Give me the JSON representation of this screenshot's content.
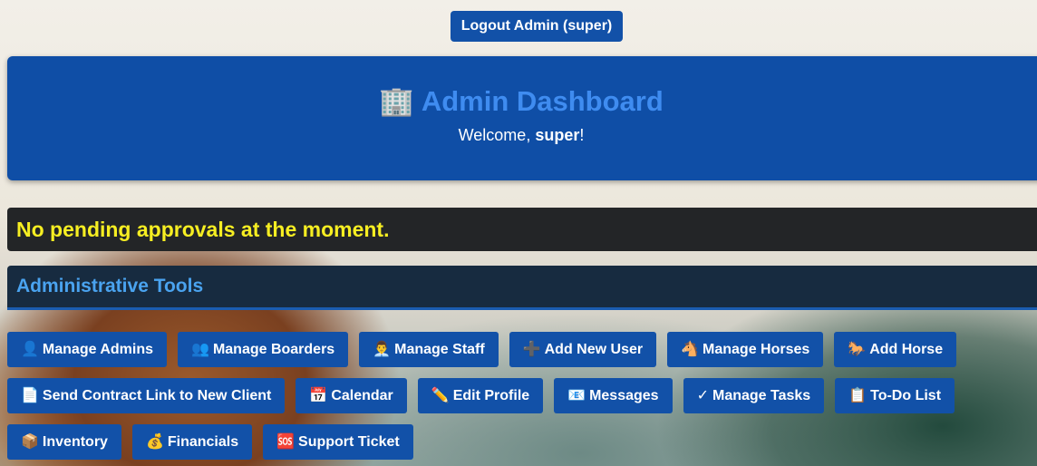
{
  "logout_label": "Logout Admin (super)",
  "header": {
    "icon": "🏢",
    "title": "Admin Dashboard",
    "welcome_prefix": "Welcome, ",
    "welcome_user": "super",
    "welcome_suffix": "!"
  },
  "pending_message": "No pending approvals at the moment.",
  "tools_heading": "Administrative Tools",
  "rows": [
    [
      {
        "icon": "👤",
        "label": "Manage Admins"
      },
      {
        "icon": "👥",
        "label": "Manage Boarders"
      },
      {
        "icon": "👨‍💼",
        "label": "Manage Staff"
      },
      {
        "icon": "➕",
        "label": "Add New User"
      },
      {
        "icon": "🐴",
        "label": "Manage Horses"
      },
      {
        "icon": "🐎",
        "label": "Add Horse"
      }
    ],
    [
      {
        "icon": "📄",
        "label": "Send Contract Link to New Client"
      },
      {
        "icon": "📅",
        "label": "Calendar"
      },
      {
        "icon": "✏️",
        "label": "Edit Profile"
      },
      {
        "icon": "📧",
        "label": "Messages"
      },
      {
        "icon": "✓",
        "label": "Manage Tasks"
      },
      {
        "icon": "📋",
        "label": "To-Do List"
      }
    ],
    [
      {
        "icon": "📦",
        "label": "Inventory"
      },
      {
        "icon": "💰",
        "label": "Financials"
      },
      {
        "icon": "🆘",
        "label": "Support Ticket"
      }
    ]
  ],
  "colors": {
    "button_bg": "#1251a8",
    "header_bg": "#0f4ea6",
    "title_color": "#3f8cf0",
    "pending_text": "#f6ee22",
    "tools_heading_text": "#4aa3ef"
  }
}
